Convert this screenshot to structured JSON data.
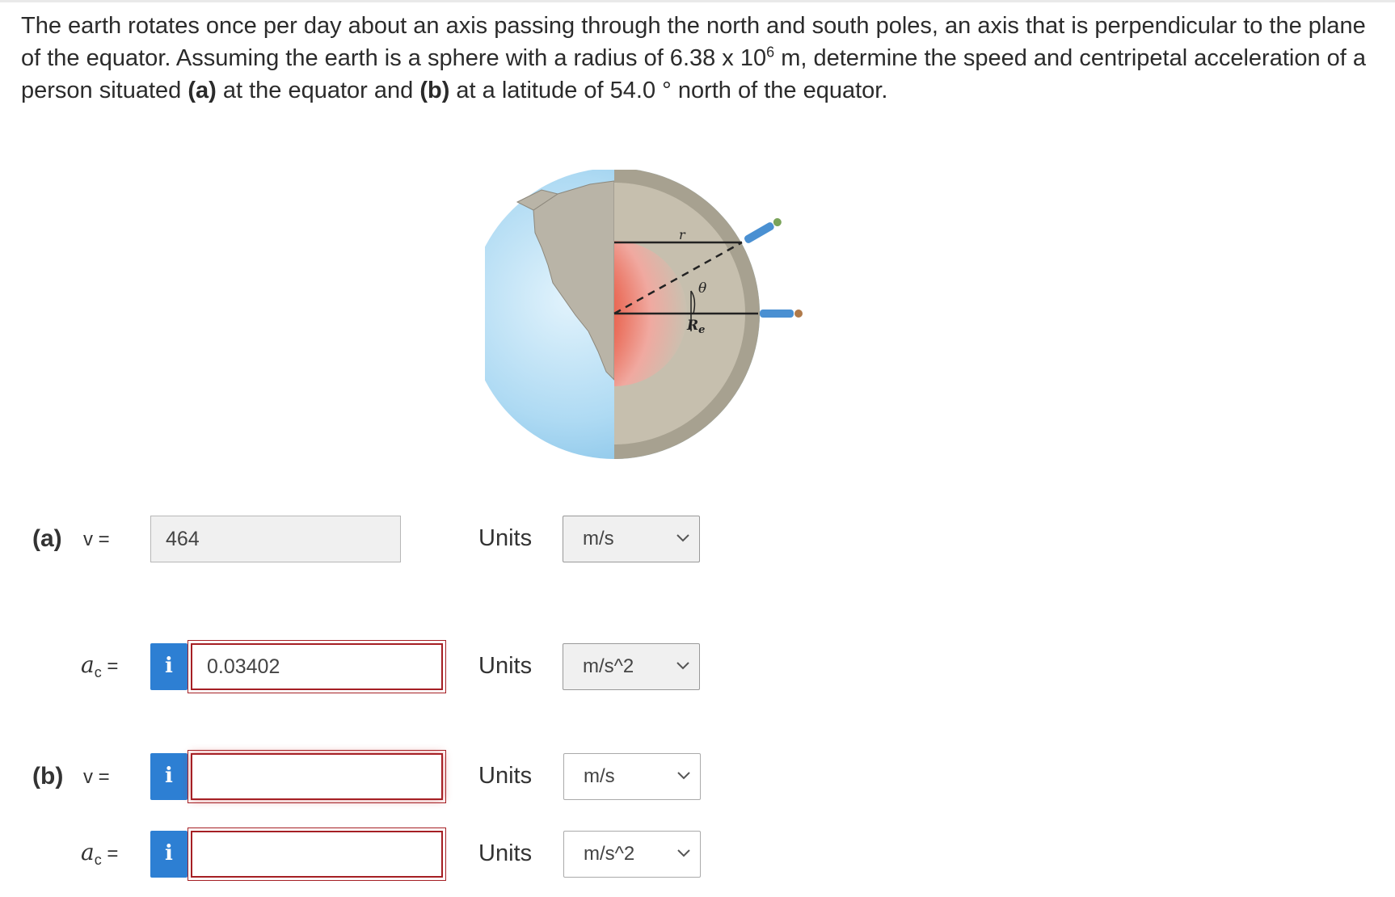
{
  "problem": {
    "text_part1": "The earth rotates once per day about an axis passing through the north and south poles, an axis that is perpendicular to the plane of the equator. Assuming the earth is a sphere with a radius of 6.38 x 10",
    "exponent": "6",
    "text_part2": " m, determine the speed and centripetal acceleration of a person situated ",
    "part_a_marker": "(a)",
    "text_part3": " at the equator and ",
    "part_b_marker": "(b)",
    "text_part4": " at a latitude of 54.0 ° north of the equator."
  },
  "figure": {
    "label_r": "r",
    "label_theta": "θ",
    "label_Re": "R",
    "label_Re_sub": "e",
    "colors": {
      "ocean": "#9fd2f0",
      "land": "#b7b2a6",
      "crust": "#a9a392",
      "core": "#e8563f"
    }
  },
  "answers": [
    {
      "part": "(a)",
      "variable": "v",
      "variable_sub": "",
      "value": "464",
      "units_label": "Units",
      "units": "m/s"
    },
    {
      "part": "",
      "variable": "a",
      "variable_sub": "c",
      "info": "i",
      "value": "0.03402",
      "units_label": "Units",
      "units": "m/s^2"
    },
    {
      "part": "(b)",
      "variable": "v",
      "variable_sub": "",
      "info": "i",
      "value": "",
      "units_label": "Units",
      "units": "m/s"
    },
    {
      "part": "",
      "variable": "a",
      "variable_sub": "c",
      "info": "i",
      "value": "",
      "units_label": "Units",
      "units": "m/s^2"
    }
  ],
  "equals": "="
}
